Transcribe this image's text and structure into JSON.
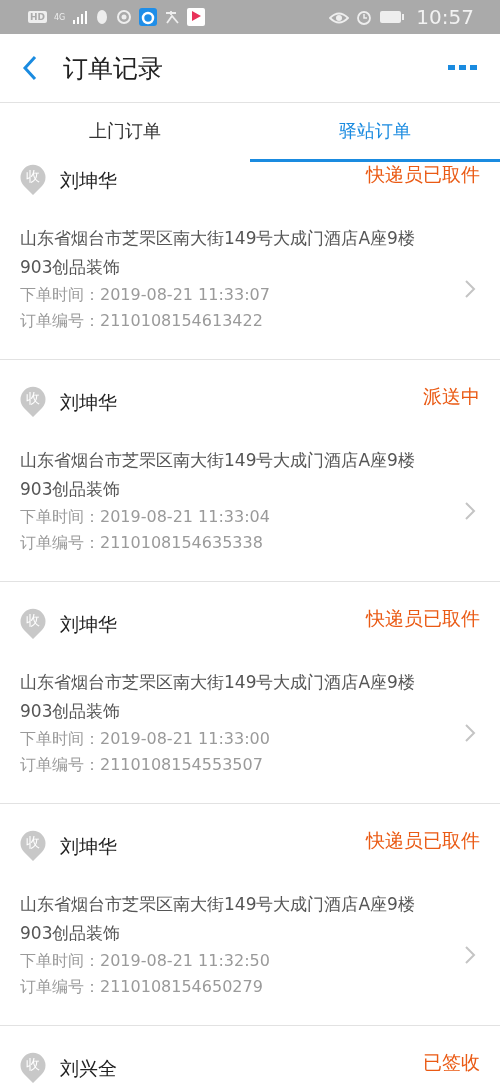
{
  "status_bar": {
    "hd": "HD",
    "network": "4G",
    "time": "10:57"
  },
  "header": {
    "title": "订单记录"
  },
  "tabs": [
    {
      "label": "上门订单",
      "selected": false
    },
    {
      "label": "驿站订单",
      "selected": true
    }
  ],
  "orders": [
    {
      "badge": "收",
      "name": "刘坤华",
      "status": "快递员已取件",
      "address": "山东省烟台市芝罘区南大街149号大成门酒店A座9楼903创品装饰",
      "time_label": "下单时间：",
      "time": "2019-08-21 11:33:07",
      "number_label": "订单编号：",
      "number": "2110108154613422"
    },
    {
      "badge": "收",
      "name": "刘坤华",
      "status": "派送中",
      "address": "山东省烟台市芝罘区南大街149号大成门酒店A座9楼903创品装饰",
      "time_label": "下单时间：",
      "time": "2019-08-21 11:33:04",
      "number_label": "订单编号：",
      "number": "2110108154635338"
    },
    {
      "badge": "收",
      "name": "刘坤华",
      "status": "快递员已取件",
      "address": "山东省烟台市芝罘区南大街149号大成门酒店A座9楼903创品装饰",
      "time_label": "下单时间：",
      "time": "2019-08-21 11:33:00",
      "number_label": "订单编号：",
      "number": "2110108154553507"
    },
    {
      "badge": "收",
      "name": "刘坤华",
      "status": "快递员已取件",
      "address": "山东省烟台市芝罘区南大街149号大成门酒店A座9楼903创品装饰",
      "time_label": "下单时间：",
      "time": "2019-08-21 11:32:50",
      "number_label": "订单编号：",
      "number": "2110108154650279"
    },
    {
      "badge": "收",
      "name": "刘兴全",
      "status": "已签收"
    }
  ]
}
